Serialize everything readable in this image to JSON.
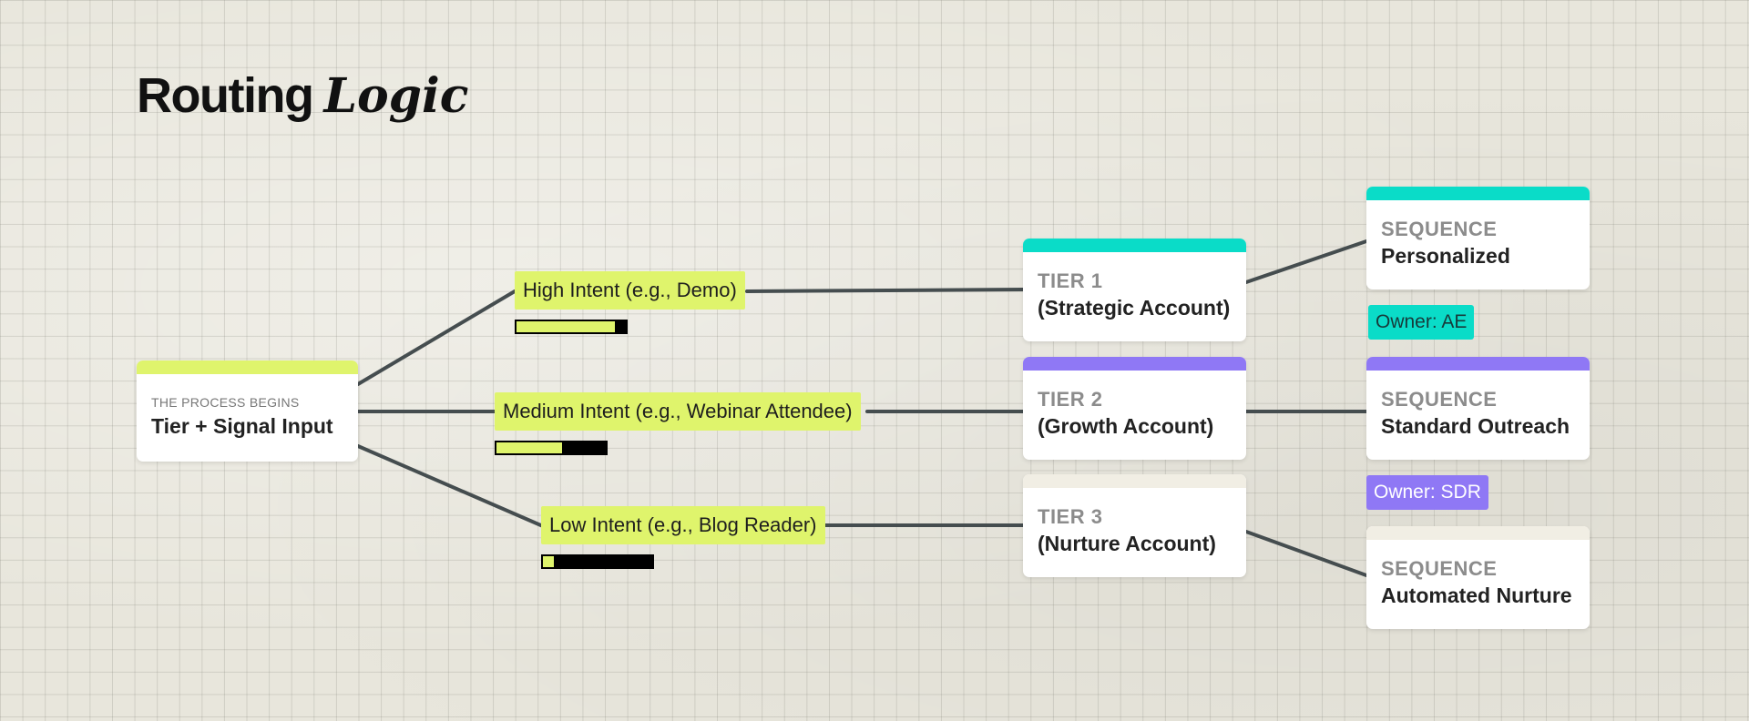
{
  "title": {
    "part1": "Routing",
    "part2": "Logic"
  },
  "colors": {
    "accent_lime": "#dff46c",
    "accent_teal": "#0adcc8",
    "accent_purple": "#8f78f5",
    "accent_cream": "#f1eee4",
    "connector": "#454d4f"
  },
  "start": {
    "label": "THE PROCESS BEGINS",
    "title": "Tier + Signal Input"
  },
  "signals": [
    {
      "label": "High Intent (e.g., Demo)",
      "level": 0.9
    },
    {
      "label": "Medium Intent (e.g., Webinar Attendee)",
      "level": 0.6
    },
    {
      "label": "Low Intent (e.g., Blog Reader)",
      "level": 0.1
    }
  ],
  "tiers": [
    {
      "label": "TIER 1",
      "title": "(Strategic Account)"
    },
    {
      "label": "TIER 2",
      "title": "(Growth Account)"
    },
    {
      "label": "TIER 3",
      "title": "(Nurture Account)"
    }
  ],
  "sequences": [
    {
      "label": "SEQUENCE",
      "title": "Personalized"
    },
    {
      "label": "SEQUENCE",
      "title": "Standard Outreach"
    },
    {
      "label": "SEQUENCE",
      "title": "Automated Nurture"
    }
  ],
  "owners": [
    {
      "label": "Owner: AE"
    },
    {
      "label": "Owner: SDR"
    }
  ]
}
